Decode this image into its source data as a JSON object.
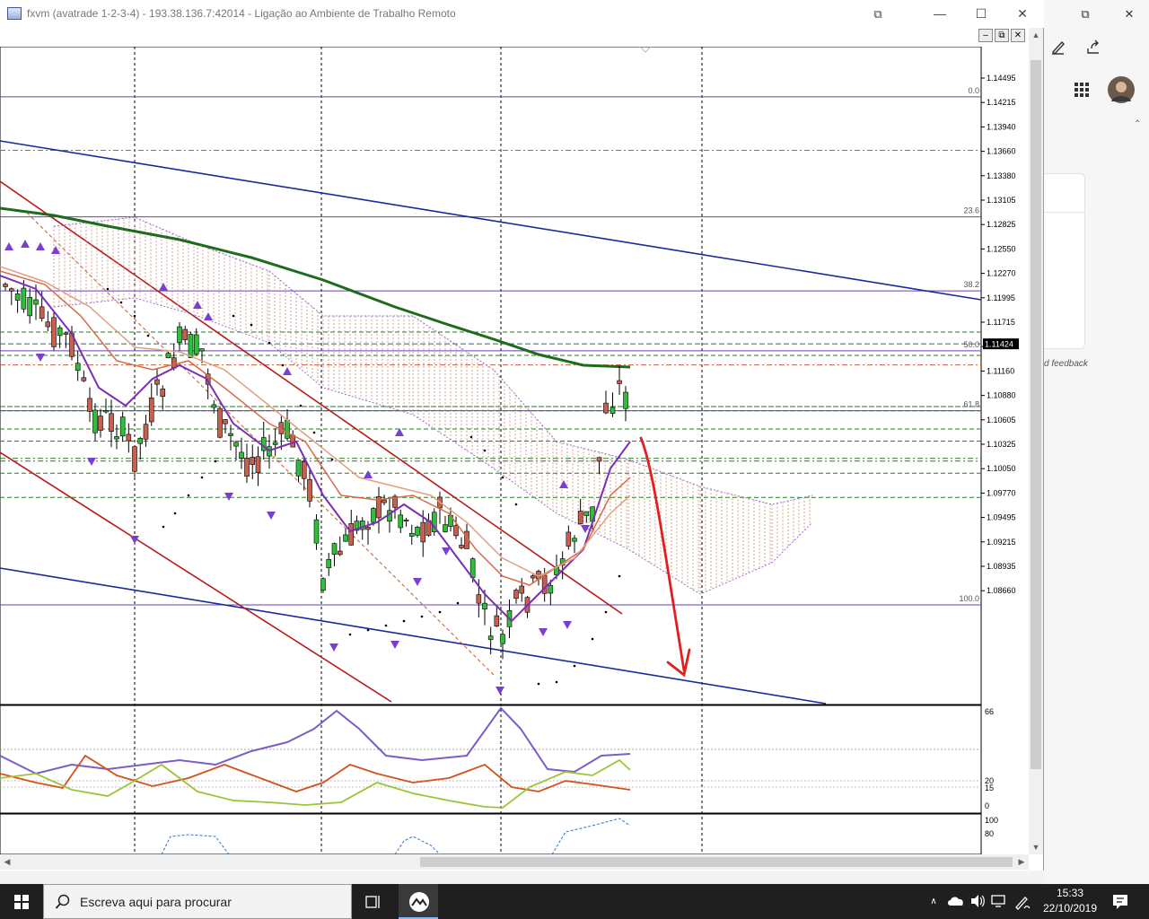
{
  "window": {
    "title": "fxvm (avatrade 1-2-3-4) - 193.38.136.7:42014 - Ligação ao Ambiente de Trabalho Remoto",
    "minimize": "—",
    "maximize": "☐",
    "close": "✕",
    "restore_icon": "⧉"
  },
  "mdi": {
    "minimize": "–",
    "restore": "⧉",
    "close": "✕"
  },
  "price_axis": {
    "ticks": [
      "1.14495",
      "1.14215",
      "1.13940",
      "1.13660",
      "1.13380",
      "1.13105",
      "1.12825",
      "1.12550",
      "1.12270",
      "1.11995",
      "1.11715",
      "1.11440",
      "1.11160",
      "1.10880",
      "1.10605",
      "1.10325",
      "1.10050",
      "1.09770",
      "1.09495",
      "1.09215",
      "1.08935",
      "1.08660"
    ],
    "current_price": "1.11424"
  },
  "fibonacci": [
    {
      "label": "0.0",
      "price": 1.14278
    },
    {
      "label": "23.6",
      "price": 1.12892
    },
    {
      "label": "38.2",
      "price": 1.12036
    },
    {
      "label": "50.0",
      "price": 1.11344
    },
    {
      "label": "61.8",
      "price": 1.10651
    },
    {
      "label": "100.0",
      "price": 1.08407
    }
  ],
  "adx_axis": {
    "ticks": [
      "66",
      "20",
      "15",
      "0"
    ]
  },
  "stoch_axis": {
    "ticks": [
      "100",
      "80"
    ]
  },
  "colors": {
    "chart_bg": "#ffffff",
    "bull": "#2fbf3a",
    "bear": "#c9604f",
    "ma_long": "#1e6b1e",
    "channel_blue": "#1a2a9a",
    "channel_red": "#b71c1c",
    "fib": "#6a3fb5",
    "arrow": "#e02020"
  },
  "side_panel": {
    "pen_icon": "pen-icon",
    "share_icon": "share-icon",
    "apps_icon": "apps-grid-icon",
    "feedback": "d feedback",
    "restore": "⧉",
    "close": "✕"
  },
  "taskbar": {
    "search_placeholder": "Escreva aqui para procurar",
    "time": "15:33",
    "date": "22/10/2019"
  }
}
